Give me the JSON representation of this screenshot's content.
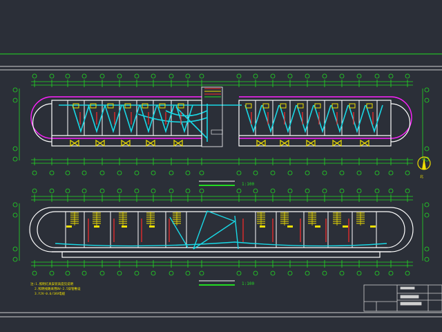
{
  "drawing": {
    "background": "#2b2f38",
    "colors": {
      "wall": "#ffffff",
      "dimension": "#22dd22",
      "grid_bubble": "#22dd22",
      "wiring": "#19d9e6",
      "fixture": "#f0e000",
      "label_red": "#ff2a2a",
      "outline_magenta": "#ff22ff",
      "border": "#cfcfcf"
    },
    "plan_upper": {
      "scale": "1:100"
    },
    "plan_lower": {
      "scale": "1:100"
    },
    "notes": {
      "line1": "注:1.照明灯具安装高度见说明",
      "line2": "2.照明线路采用BV-2.5穿管敷设",
      "line3": "3.YJV-0.6/1KV电缆"
    },
    "north_label": "北",
    "title_block": {
      "rows": [
        "",
        "",
        "",
        ""
      ]
    }
  }
}
